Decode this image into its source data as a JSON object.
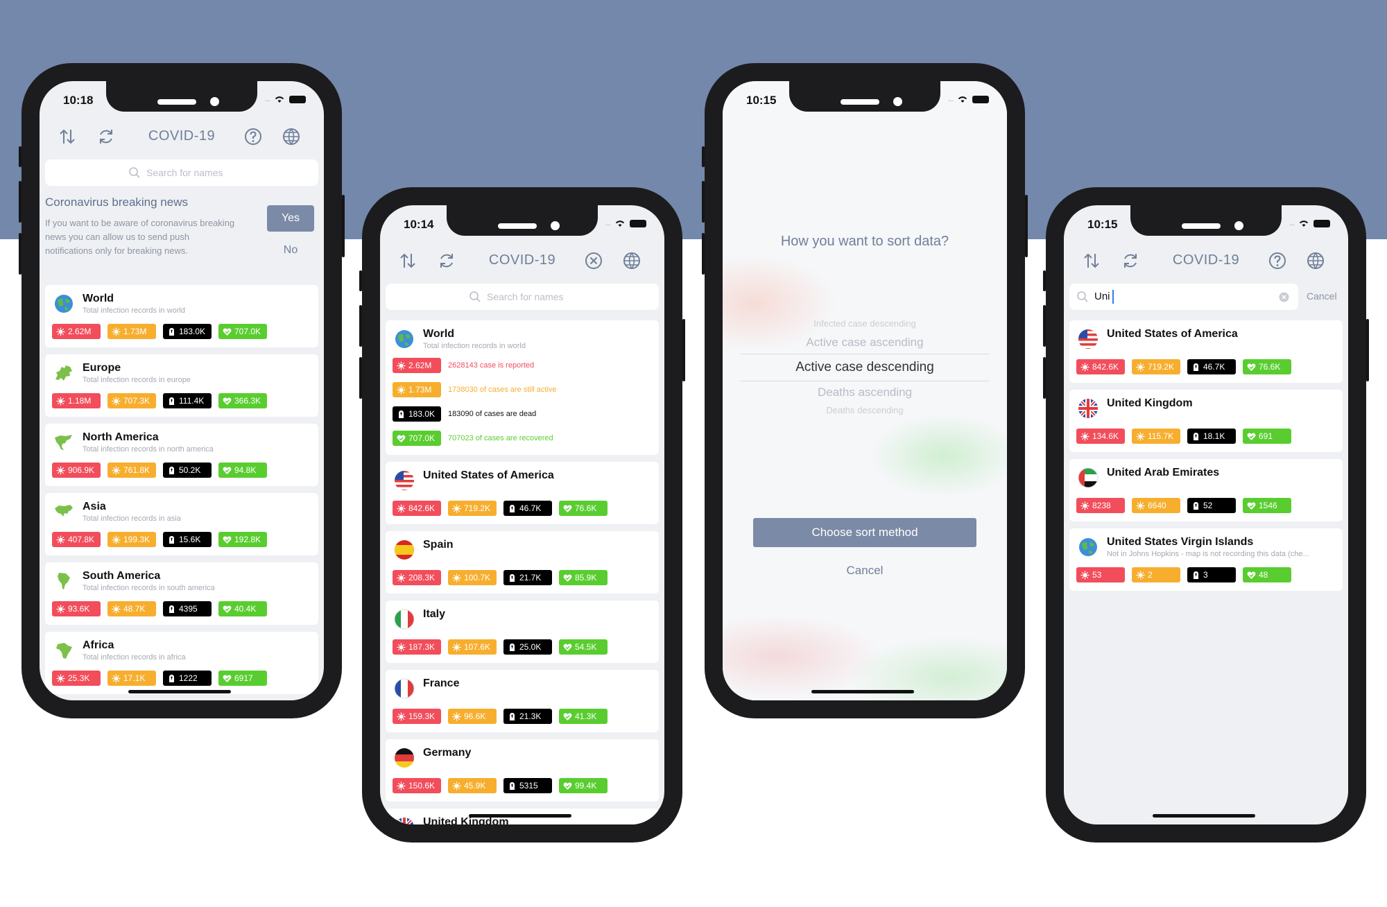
{
  "colors": {
    "background_band": "#7388aa",
    "infected": "#f24d5b",
    "active": "#f7ae2e",
    "dead": "#000000",
    "recovered": "#59cd30",
    "accent": "#7b8aa6"
  },
  "phone1": {
    "time": "10:18",
    "title": "COVID-19",
    "search_placeholder": "Search for names",
    "news": {
      "title": "Coronavirus breaking news",
      "body": "If you want to be aware of coronavirus breaking news you can allow us to send push notifications only for breaking news.",
      "yes": "Yes",
      "no": "No"
    },
    "items": [
      {
        "name": "World",
        "sub": "Total infection records in world",
        "icon": "globe-icon",
        "infected": "2.62M",
        "active": "1.73M",
        "dead": "183.0K",
        "recovered": "707.0K"
      },
      {
        "name": "Europe",
        "sub": "Total infection records in europe",
        "icon": "europe-map-icon",
        "infected": "1.18M",
        "active": "707.3K",
        "dead": "111.4K",
        "recovered": "366.3K"
      },
      {
        "name": "North America",
        "sub": "Total infection records in north america",
        "icon": "north-america-map-icon",
        "infected": "906.9K",
        "active": "761.8K",
        "dead": "50.2K",
        "recovered": "94.8K"
      },
      {
        "name": "Asia",
        "sub": "Total infection records in asia",
        "icon": "asia-map-icon",
        "infected": "407.8K",
        "active": "199.3K",
        "dead": "15.6K",
        "recovered": "192.8K"
      },
      {
        "name": "South America",
        "sub": "Total infection records in south america",
        "icon": "south-america-map-icon",
        "infected": "93.6K",
        "active": "48.7K",
        "dead": "4395",
        "recovered": "40.4K"
      },
      {
        "name": "Africa",
        "sub": "Total infection records in africa",
        "icon": "africa-map-icon",
        "infected": "25.3K",
        "active": "17.1K",
        "dead": "1222",
        "recovered": "6917"
      }
    ]
  },
  "phone2": {
    "time": "10:14",
    "title": "COVID-19",
    "search_placeholder": "Search for names",
    "world": {
      "name": "World",
      "sub": "Total infection records in world",
      "infected": "2.62M",
      "infected_text": "2628143 case is reported",
      "active": "1.73M",
      "active_text": "1738030 of cases are still active",
      "dead": "183.0K",
      "dead_text": "183090 of cases are dead",
      "recovered": "707.0K",
      "recovered_text": "707023 of cases are recovered"
    },
    "items": [
      {
        "name": "United States of America",
        "icon": "usa-flag-icon",
        "infected": "842.6K",
        "active": "719.2K",
        "dead": "46.7K",
        "recovered": "76.6K"
      },
      {
        "name": "Spain",
        "icon": "spain-flag-icon",
        "infected": "208.3K",
        "active": "100.7K",
        "dead": "21.7K",
        "recovered": "85.9K"
      },
      {
        "name": "Italy",
        "icon": "italy-flag-icon",
        "infected": "187.3K",
        "active": "107.6K",
        "dead": "25.0K",
        "recovered": "54.5K"
      },
      {
        "name": "France",
        "icon": "france-flag-icon",
        "infected": "159.3K",
        "active": "96.6K",
        "dead": "21.3K",
        "recovered": "41.3K"
      },
      {
        "name": "Germany",
        "icon": "germany-flag-icon",
        "infected": "150.6K",
        "active": "45.9K",
        "dead": "5315",
        "recovered": "99.4K"
      }
    ],
    "partial_item": {
      "name": "United Kingdom",
      "icon": "uk-flag-icon"
    }
  },
  "phone3": {
    "time": "10:15",
    "question": "How you want to sort data?",
    "options": [
      "Infected case descending",
      "Active case ascending",
      "Active case descending",
      "Deaths ascending",
      "Deaths descending"
    ],
    "selected": "Active case descending",
    "choose": "Choose sort method",
    "cancel": "Cancel"
  },
  "phone4": {
    "time": "10:15",
    "title": "COVID-19",
    "search_value": "Uni",
    "cancel": "Cancel",
    "items": [
      {
        "name": "United States of America",
        "sub": "",
        "icon": "usa-flag-icon",
        "infected": "842.6K",
        "active": "719.2K",
        "dead": "46.7K",
        "recovered": "76.6K"
      },
      {
        "name": "United Kingdom",
        "sub": "",
        "icon": "uk-flag-icon",
        "infected": "134.6K",
        "active": "115.7K",
        "dead": "18.1K",
        "recovered": "691"
      },
      {
        "name": "United Arab Emirates",
        "sub": "",
        "icon": "uae-flag-icon",
        "infected": "8238",
        "active": "6640",
        "dead": "52",
        "recovered": "1546"
      },
      {
        "name": "United States Virgin Islands",
        "sub": "Not in Johns Hopkins - map is not recording this data (che...",
        "icon": "globe-icon",
        "infected": "53",
        "active": "2",
        "dead": "3",
        "recovered": "48"
      }
    ]
  }
}
